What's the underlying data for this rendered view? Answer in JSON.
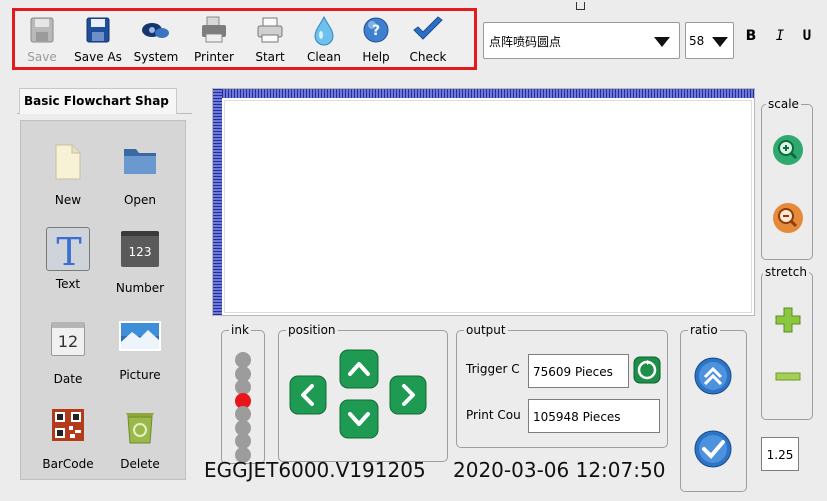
{
  "toolbar": {
    "items": [
      {
        "label": "Save",
        "icon": "floppy-disk-icon",
        "enabled": false
      },
      {
        "label": "Save As",
        "icon": "floppy-save-as-icon",
        "enabled": true
      },
      {
        "label": "System",
        "icon": "system-gear-icon",
        "enabled": true
      },
      {
        "label": "Printer",
        "icon": "printer-icon",
        "enabled": true
      },
      {
        "label": "Start",
        "icon": "start-print-icon",
        "enabled": true
      },
      {
        "label": "Clean",
        "icon": "water-drop-icon",
        "enabled": true
      },
      {
        "label": "Help",
        "icon": "help-icon",
        "enabled": true
      },
      {
        "label": "Check",
        "icon": "checkmark-icon",
        "enabled": true
      }
    ],
    "highlight_color": "#e21c1c"
  },
  "font": {
    "selected": "点阵喷码圆点",
    "size": "58",
    "bold_label": "B",
    "italic_label": "I",
    "underline_label": "U"
  },
  "left_panel": {
    "tab": "Basic Flowchart Shap",
    "items": [
      {
        "label": "New",
        "icon": "new-document-icon"
      },
      {
        "label": "Open",
        "icon": "folder-icon"
      },
      {
        "label": "Text",
        "icon": "text-tool-icon",
        "selected": true
      },
      {
        "label": "Number",
        "icon": "number-tool-icon",
        "glyph": "123"
      },
      {
        "label": "Date",
        "icon": "calendar-icon",
        "glyph": "12"
      },
      {
        "label": "Picture",
        "icon": "picture-icon"
      },
      {
        "label": "BarCode",
        "icon": "qr-barcode-icon"
      },
      {
        "label": "Delete",
        "icon": "recycle-bin-icon"
      }
    ]
  },
  "ink": {
    "title": "ink",
    "levels": 8,
    "active_index": 3,
    "active_color": "#e8151a"
  },
  "position": {
    "title": "position"
  },
  "output": {
    "title": "output",
    "trigger_label": "Trigger C",
    "trigger_value": "75609  Pieces",
    "print_label": "Print Cou",
    "print_value": "105948  Pieces"
  },
  "ratio": {
    "title": "ratio"
  },
  "scale": {
    "title": "scale"
  },
  "stretch": {
    "title": "stretch",
    "value": "1.25"
  },
  "status": {
    "version": "EGGJET6000.V191205",
    "datetime": "2020-03-06 12:07:50"
  }
}
